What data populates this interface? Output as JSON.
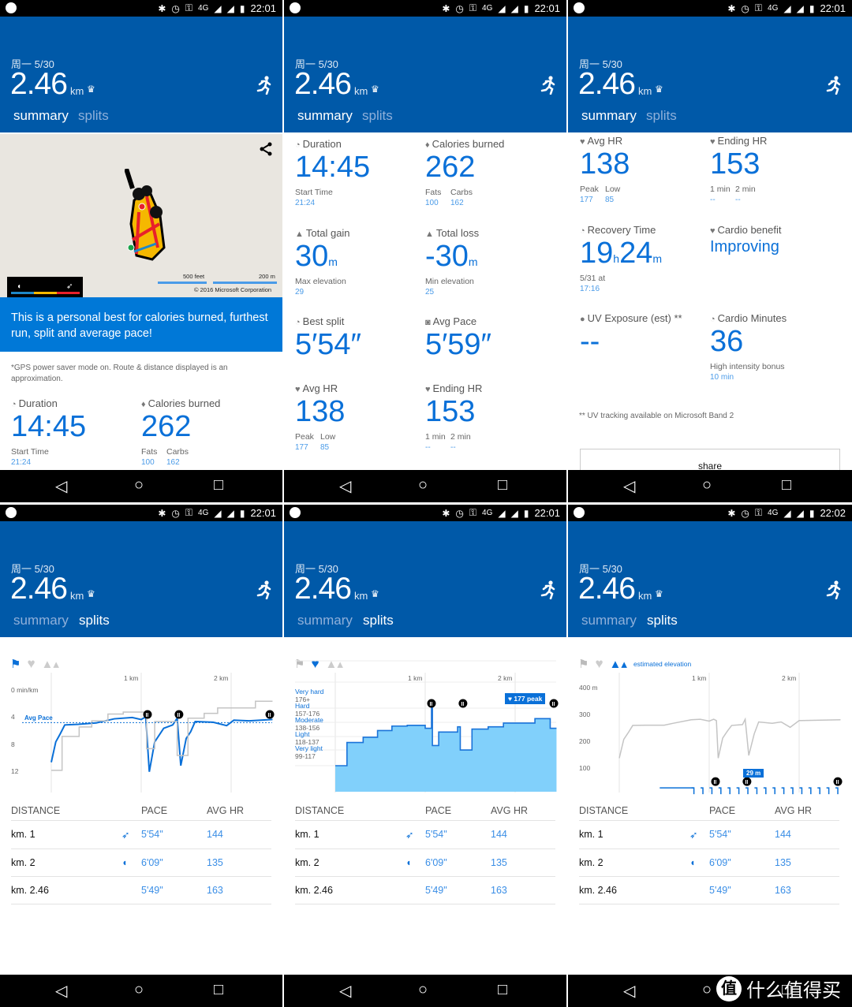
{
  "status_bar": {
    "network": "4G",
    "times": [
      "22:01",
      "22:01",
      "22:01",
      "22:01",
      "22:01",
      "22:02"
    ]
  },
  "header": {
    "date": "周一 5/30",
    "distance": "2.46",
    "unit": "km",
    "tabs": [
      "summary",
      "splits"
    ]
  },
  "nav": {
    "back": "◁",
    "home": "○",
    "recents": "□"
  },
  "map": {
    "scale_feet": "500 feet",
    "scale_m": "200 m",
    "copyright": "© 2016 Microsoft Corporation"
  },
  "banner": "This is a personal best for calories burned, furthest run, split and average pace!",
  "gps_note": "*GPS power saver mode on. Route & distance displayed is an approximation.",
  "stats": {
    "duration": {
      "label": "Duration",
      "value": "14:45",
      "subs": [
        {
          "label": "Start Time",
          "value": "21:24"
        }
      ]
    },
    "calories": {
      "label": "Calories burned",
      "value": "262",
      "subs": [
        {
          "label": "Fats",
          "value": "100"
        },
        {
          "label": "Carbs",
          "value": "162"
        }
      ]
    },
    "total_gain": {
      "label": "Total gain",
      "value": "30",
      "unit": "m",
      "subs": [
        {
          "label": "Max elevation",
          "value": "29"
        }
      ]
    },
    "total_loss": {
      "label": "Total loss",
      "value": "-30",
      "unit": "m",
      "subs": [
        {
          "label": "Min elevation",
          "value": "25"
        }
      ]
    },
    "best_split": {
      "label": "Best split",
      "value": "5′54″",
      "subs": []
    },
    "avg_pace": {
      "label": "Avg Pace",
      "value": "5′59″",
      "subs": []
    },
    "avg_hr": {
      "label": "Avg HR",
      "value": "138",
      "subs": [
        {
          "label": "Peak",
          "value": "177"
        },
        {
          "label": "Low",
          "value": "85"
        }
      ]
    },
    "ending_hr": {
      "label": "Ending HR",
      "value": "153",
      "subs": [
        {
          "label": "1 min",
          "value": "--"
        },
        {
          "label": "2 min",
          "value": "--"
        }
      ]
    },
    "recovery": {
      "label": "Recovery Time",
      "value": "19",
      "unit": "h",
      "value2": "24",
      "unit2": "m",
      "subs": [
        {
          "label": "5/31 at",
          "value": "17:16"
        }
      ]
    },
    "cardio_benefit": {
      "label": "Cardio benefit",
      "value": "Improving",
      "subs": []
    },
    "uv": {
      "label": "UV Exposure (est) **",
      "value": "--",
      "subs": []
    },
    "cardio_minutes": {
      "label": "Cardio Minutes",
      "value": "36",
      "subs": [
        {
          "label": "High intensity bonus",
          "value": "10 min"
        }
      ]
    }
  },
  "uv_footnote": "** UV tracking available on Microsoft Band 2",
  "share_label": "share",
  "splits": {
    "headers": [
      "DISTANCE",
      "PACE",
      "AVG HR"
    ],
    "rows": [
      {
        "distance": "km. 1",
        "icon": "cheetah-icon",
        "pace": "5'54\"",
        "avg_hr": "144"
      },
      {
        "distance": "km. 2",
        "icon": "snail-icon",
        "pace": "6'09\"",
        "avg_hr": "135"
      },
      {
        "distance": "km. 2.46",
        "icon": "",
        "pace": "5'49\"",
        "avg_hr": "163"
      }
    ]
  },
  "colors": {
    "header": "#0059a8",
    "accent": "#0a70d8",
    "banner": "#0078d7",
    "hr_fill": "#81d0fb"
  },
  "chart_data": [
    {
      "type": "line",
      "xlabel": "",
      "ylabel": "",
      "x_ticks": [
        "1 km",
        "2 km"
      ],
      "x_tick_values": [
        1,
        2
      ],
      "xlim": [
        0,
        2.46
      ],
      "y_ticks": [
        "0 min/km",
        "4",
        "8",
        "12"
      ],
      "y_tick_values": [
        0,
        4,
        8,
        12
      ],
      "ylim": [
        0,
        14
      ],
      "y_inverted": true,
      "avg_label": "Avg Pace",
      "avg_value": 5.98,
      "pauses": [
        1.07,
        1.42,
        2.43
      ],
      "series": [
        {
          "color": "#0a70d8",
          "points": [
            [
              0,
              11
            ],
            [
              0.05,
              8
            ],
            [
              0.1,
              6.8
            ],
            [
              0.15,
              5.5
            ],
            [
              0.3,
              5.4
            ],
            [
              0.5,
              5.2
            ],
            [
              0.7,
              4.6
            ],
            [
              0.9,
              4.4
            ],
            [
              1.0,
              4.7
            ],
            [
              1.05,
              4.3
            ],
            [
              1.09,
              12.4
            ],
            [
              1.15,
              8
            ],
            [
              1.25,
              6
            ],
            [
              1.35,
              5.5
            ],
            [
              1.4,
              4.5
            ],
            [
              1.44,
              11.5
            ],
            [
              1.5,
              7.5
            ],
            [
              1.55,
              6.5
            ],
            [
              1.6,
              5
            ],
            [
              1.8,
              5.1
            ],
            [
              1.95,
              5.6
            ],
            [
              2.03,
              4.8
            ],
            [
              2.2,
              4.9
            ],
            [
              2.46,
              4.7
            ]
          ]
        },
        {
          "color": "#c4c4c4",
          "points": [
            [
              0,
              12.2
            ],
            [
              0.12,
              12.2
            ],
            [
              0.12,
              7.2
            ],
            [
              0.31,
              7.2
            ],
            [
              0.31,
              5.8
            ],
            [
              0.45,
              5.8
            ],
            [
              0.45,
              4.9
            ],
            [
              0.63,
              4.9
            ],
            [
              0.63,
              3.9
            ],
            [
              0.8,
              3.9
            ],
            [
              0.8,
              3.6
            ],
            [
              1.03,
              3.6
            ],
            [
              1.03,
              3.9
            ],
            [
              1.06,
              3.9
            ],
            [
              1.06,
              9
            ],
            [
              1.15,
              9
            ],
            [
              1.15,
              5
            ],
            [
              1.4,
              5
            ],
            [
              1.4,
              10
            ],
            [
              1.52,
              10
            ],
            [
              1.52,
              4.5
            ],
            [
              1.7,
              4.5
            ],
            [
              1.7,
              3.8
            ],
            [
              1.85,
              3.8
            ],
            [
              1.85,
              3
            ],
            [
              2.27,
              3
            ],
            [
              2.27,
              2
            ],
            [
              2.43,
              2
            ],
            [
              2.46,
              2
            ]
          ]
        }
      ]
    },
    {
      "type": "area",
      "xlabel": "",
      "ylabel": "",
      "x_ticks": [
        "1 km",
        "2 km"
      ],
      "x_tick_values": [
        1,
        2
      ],
      "xlim": [
        0,
        2.46
      ],
      "ylim": [
        60,
        190
      ],
      "zones": [
        {
          "name": "Very hard",
          "range": "176+"
        },
        {
          "name": "Hard",
          "range": "157-176"
        },
        {
          "name": "Moderate",
          "range": "138-156"
        },
        {
          "name": "Light",
          "range": "118-137"
        },
        {
          "name": "Very light",
          "range": "99-117"
        }
      ],
      "peak_label": "♥ 177 peak",
      "peak_value": 177,
      "pauses": [
        1.07,
        1.42,
        2.43
      ],
      "series": [
        {
          "color": "#1a73d9",
          "points": [
            [
              0,
              100
            ],
            [
              0.13,
              100
            ],
            [
              0.13,
              131
            ],
            [
              0.31,
              131
            ],
            [
              0.31,
              138
            ],
            [
              0.47,
              138
            ],
            [
              0.47,
              147
            ],
            [
              0.63,
              147
            ],
            [
              0.63,
              153
            ],
            [
              0.8,
              153
            ],
            [
              0.8,
              154
            ],
            [
              1.0,
              154
            ],
            [
              1.0,
              150
            ],
            [
              1.07,
              150
            ],
            [
              1.07,
              177
            ],
            [
              1.08,
              177
            ],
            [
              1.08,
              127
            ],
            [
              1.15,
              127
            ],
            [
              1.15,
              145
            ],
            [
              1.36,
              145
            ],
            [
              1.36,
              152
            ],
            [
              1.39,
              152
            ],
            [
              1.39,
              121
            ],
            [
              1.52,
              121
            ],
            [
              1.52,
              149
            ],
            [
              1.7,
              149
            ],
            [
              1.7,
              152
            ],
            [
              1.87,
              152
            ],
            [
              1.87,
              157
            ],
            [
              2.22,
              157
            ],
            [
              2.22,
              163
            ],
            [
              2.39,
              163
            ],
            [
              2.39,
              150
            ],
            [
              2.46,
              150
            ]
          ]
        }
      ]
    },
    {
      "type": "line",
      "xlabel": "",
      "ylabel": "",
      "legend": "estimated elevation",
      "x_ticks": [
        "1 km",
        "2 km"
      ],
      "x_tick_values": [
        1,
        2
      ],
      "xlim": [
        0,
        2.46
      ],
      "y_ticks": [
        "400 m",
        "300",
        "200",
        "100"
      ],
      "y_tick_values": [
        400,
        300,
        200,
        100
      ],
      "ylim": [
        0,
        450
      ],
      "marker_label": "29 m",
      "marker_value": 29,
      "pauses": [
        1.07,
        1.42,
        2.43
      ],
      "series": [
        {
          "color": "#c4c4c4",
          "points": [
            [
              0,
              140
            ],
            [
              0.05,
              210
            ],
            [
              0.1,
              235
            ],
            [
              0.15,
              262
            ],
            [
              0.3,
              263
            ],
            [
              0.5,
              263
            ],
            [
              0.6,
              270
            ],
            [
              0.8,
              283
            ],
            [
              0.9,
              285
            ],
            [
              1.0,
              278
            ],
            [
              1.05,
              285
            ],
            [
              1.08,
              280
            ],
            [
              1.1,
              140
            ],
            [
              1.15,
              215
            ],
            [
              1.2,
              240
            ],
            [
              1.25,
              262
            ],
            [
              1.37,
              265
            ],
            [
              1.4,
              285
            ],
            [
              1.44,
              150
            ],
            [
              1.5,
              230
            ],
            [
              1.55,
              275
            ],
            [
              1.7,
              270
            ],
            [
              1.8,
              275
            ],
            [
              1.9,
              255
            ],
            [
              2.0,
              280
            ],
            [
              2.46,
              283
            ]
          ]
        },
        {
          "name": "estimated elevation",
          "color": "#0a70d8",
          "points": [
            [
              0.45,
              29
            ],
            [
              0.83,
              29
            ],
            [
              2.46,
              29
            ]
          ]
        }
      ]
    }
  ],
  "watermark": "什么值得买"
}
